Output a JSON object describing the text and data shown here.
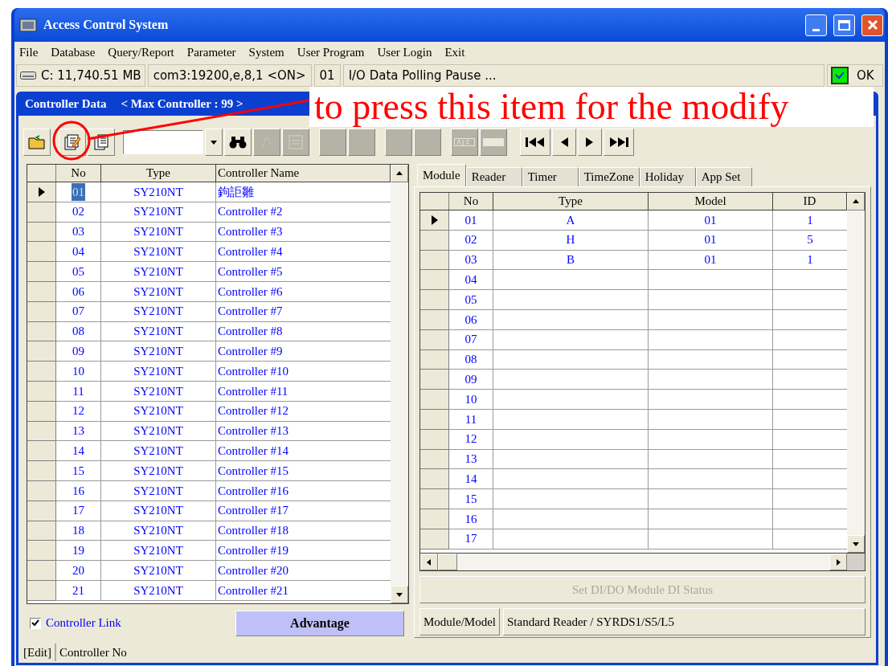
{
  "window": {
    "title": "Access Control System"
  },
  "menu": [
    "File",
    "Database",
    "Query/Report",
    "Parameter",
    "System",
    "User Program",
    "User Login",
    "Exit"
  ],
  "status_bar": {
    "disk": "C: 11,740.51 MB",
    "port": "com3:19200,e,8,1 <ON>",
    "controller": "01",
    "message": "I/O Data Polling Pause ...",
    "ok_checked": true,
    "ok_label": "OK"
  },
  "annotation": {
    "text": "to press this item for the modify"
  },
  "controller_window": {
    "title": "Controller Data",
    "subtitle": "< Max Controller : 99 >"
  },
  "controller_table": {
    "columns": [
      "No",
      "Type",
      "Controller Name"
    ],
    "rows": [
      {
        "no": "01",
        "type": "SY210NT",
        "name": "鉤詎雛",
        "selected": true
      },
      {
        "no": "02",
        "type": "SY210NT",
        "name": "Controller #2",
        "selected": false
      },
      {
        "no": "03",
        "type": "SY210NT",
        "name": "Controller #3",
        "selected": false
      },
      {
        "no": "04",
        "type": "SY210NT",
        "name": "Controller #4",
        "selected": false
      },
      {
        "no": "05",
        "type": "SY210NT",
        "name": "Controller #5",
        "selected": false
      },
      {
        "no": "06",
        "type": "SY210NT",
        "name": "Controller #6",
        "selected": false
      },
      {
        "no": "07",
        "type": "SY210NT",
        "name": "Controller #7",
        "selected": false
      },
      {
        "no": "08",
        "type": "SY210NT",
        "name": "Controller #8",
        "selected": false
      },
      {
        "no": "09",
        "type": "SY210NT",
        "name": "Controller #9",
        "selected": false
      },
      {
        "no": "10",
        "type": "SY210NT",
        "name": "Controller #10",
        "selected": false
      },
      {
        "no": "11",
        "type": "SY210NT",
        "name": "Controller #11",
        "selected": false
      },
      {
        "no": "12",
        "type": "SY210NT",
        "name": "Controller #12",
        "selected": false
      },
      {
        "no": "13",
        "type": "SY210NT",
        "name": "Controller #13",
        "selected": false
      },
      {
        "no": "14",
        "type": "SY210NT",
        "name": "Controller #14",
        "selected": false
      },
      {
        "no": "15",
        "type": "SY210NT",
        "name": "Controller #15",
        "selected": false
      },
      {
        "no": "16",
        "type": "SY210NT",
        "name": "Controller #16",
        "selected": false
      },
      {
        "no": "17",
        "type": "SY210NT",
        "name": "Controller #17",
        "selected": false
      },
      {
        "no": "18",
        "type": "SY210NT",
        "name": "Controller #18",
        "selected": false
      },
      {
        "no": "19",
        "type": "SY210NT",
        "name": "Controller #19",
        "selected": false
      },
      {
        "no": "20",
        "type": "SY210NT",
        "name": "Controller #20",
        "selected": false
      },
      {
        "no": "21",
        "type": "SY210NT",
        "name": "Controller #21",
        "selected": false
      }
    ]
  },
  "tabs": [
    {
      "label": "Module",
      "selected": true
    },
    {
      "label": "Reader",
      "selected": false
    },
    {
      "label": "Timer",
      "selected": false
    },
    {
      "label": "TimeZone",
      "selected": false
    },
    {
      "label": "Holiday",
      "selected": false
    },
    {
      "label": "App Set",
      "selected": false
    }
  ],
  "module_table": {
    "columns": [
      "No",
      "Type",
      "Model",
      "ID"
    ],
    "rows": [
      {
        "no": "01",
        "type": "A",
        "model": "01",
        "id": "1",
        "selected": true
      },
      {
        "no": "02",
        "type": "H",
        "model": "01",
        "id": "5",
        "selected": false
      },
      {
        "no": "03",
        "type": "B",
        "model": "01",
        "id": "1",
        "selected": false
      },
      {
        "no": "04",
        "selected": false
      },
      {
        "no": "05",
        "selected": false
      },
      {
        "no": "06",
        "selected": false
      },
      {
        "no": "07",
        "selected": false
      },
      {
        "no": "08",
        "selected": false
      },
      {
        "no": "09",
        "selected": false
      },
      {
        "no": "10",
        "selected": false
      },
      {
        "no": "11",
        "selected": false
      },
      {
        "no": "12",
        "selected": false
      },
      {
        "no": "13",
        "selected": false
      },
      {
        "no": "14",
        "selected": false
      },
      {
        "no": "15",
        "selected": false
      },
      {
        "no": "16",
        "selected": false
      },
      {
        "no": "17",
        "selected": false
      }
    ]
  },
  "set_button": {
    "label": "Set DI/DO Module DI Status",
    "disabled": true
  },
  "module_model": {
    "label": "Module/Model",
    "value": "Standard Reader / SYRDS1/S5/L5"
  },
  "controller_link": {
    "label": "Controller Link",
    "checked": true
  },
  "advantage_button": {
    "label": "Advantage"
  },
  "edit_status": {
    "mode": "[Edit]",
    "field": "Controller No"
  }
}
